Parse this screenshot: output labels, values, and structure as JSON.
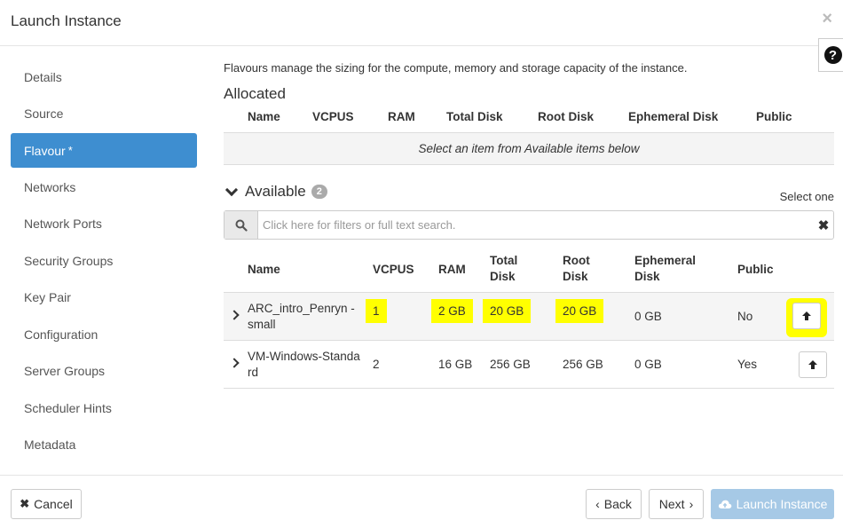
{
  "dialog": {
    "title": "Launch Instance",
    "close_icon": "×",
    "help_icon": "?"
  },
  "sidebar": {
    "items": [
      {
        "label": "Details"
      },
      {
        "label": "Source"
      },
      {
        "label": "Flavour",
        "required_mark": "*",
        "active": true
      },
      {
        "label": "Networks"
      },
      {
        "label": "Network Ports"
      },
      {
        "label": "Security Groups"
      },
      {
        "label": "Key Pair"
      },
      {
        "label": "Configuration"
      },
      {
        "label": "Server Groups"
      },
      {
        "label": "Scheduler Hints"
      },
      {
        "label": "Metadata"
      }
    ]
  },
  "main": {
    "description": "Flavours manage the sizing for the compute, memory and storage capacity of the instance.",
    "allocated": {
      "title": "Allocated",
      "columns": [
        "Name",
        "VCPUS",
        "RAM",
        "Total Disk",
        "Root Disk",
        "Ephemeral Disk",
        "Public"
      ],
      "empty_text": "Select an item from Available items below"
    },
    "available": {
      "title": "Available",
      "count": "2",
      "select_hint": "Select one",
      "search_placeholder": "Click here for filters or full text search.",
      "clear_icon": "✖",
      "columns": {
        "name": "Name",
        "vcpus": "VCPUS",
        "ram": "RAM",
        "total_disk_1": "Total",
        "total_disk_2": "Disk",
        "root_disk_1": "Root",
        "root_disk_2": "Disk",
        "ephemeral_disk_1": "Ephemeral",
        "ephemeral_disk_2": "Disk",
        "public": "Public"
      },
      "rows": [
        {
          "name_1": "ARC_intro_Penryn -",
          "name_2": "small",
          "vcpus": "1",
          "ram": "2 GB",
          "total_disk": "20 GB",
          "root_disk": "20 GB",
          "ephemeral_disk": "0 GB",
          "public": "No"
        },
        {
          "name_1": "VM-Windows-Standa",
          "name_2": "rd",
          "vcpus": "2",
          "ram": "16 GB",
          "total_disk": "256 GB",
          "root_disk": "256 GB",
          "ephemeral_disk": "0 GB",
          "public": "Yes"
        }
      ]
    }
  },
  "footer": {
    "cancel_label": "Cancel",
    "back_label": "Back",
    "next_label": "Next",
    "launch_label": "Launch Instance"
  },
  "colors": {
    "accent": "#3e8ed0",
    "highlight": "#ffff00",
    "launch_disabled": "#a6c9e6"
  }
}
